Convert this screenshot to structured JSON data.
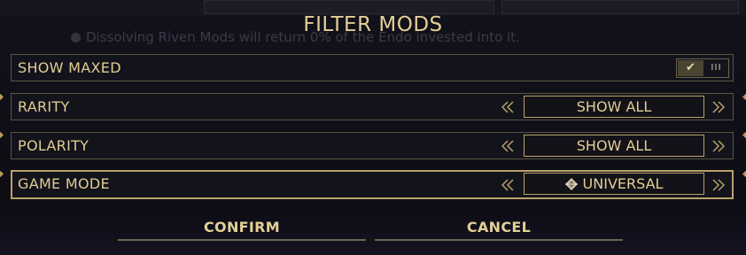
{
  "modal": {
    "title": "FILTER MODS"
  },
  "background": {
    "notice": "Dissolving Riven Mods will return 0% of the Endo invested into it.",
    "notice_icon": "info-icon"
  },
  "rows": {
    "show_maxed": {
      "label": "SHOW MAXED",
      "toggle_on_icon": "checkmark-icon",
      "toggle_off_icon": "bars-icon",
      "value": true
    },
    "rarity": {
      "label": "RARITY",
      "value": "SHOW ALL",
      "prev_icon": "double-chevron-left-icon",
      "next_icon": "double-chevron-right-icon"
    },
    "polarity": {
      "label": "POLARITY",
      "value": "SHOW ALL",
      "prev_icon": "double-chevron-left-icon",
      "next_icon": "double-chevron-right-icon"
    },
    "game_mode": {
      "label": "GAME MODE",
      "value": "UNIVERSAL",
      "value_icon": "diamond-icon",
      "prev_icon": "double-chevron-left-icon",
      "next_icon": "double-chevron-right-icon",
      "focused": true
    }
  },
  "footer": {
    "confirm_label": "CONFIRM",
    "cancel_label": "CANCEL"
  },
  "colors": {
    "accent": "#e2cf95",
    "border": "#5b5443",
    "background": "#0c0b12"
  }
}
